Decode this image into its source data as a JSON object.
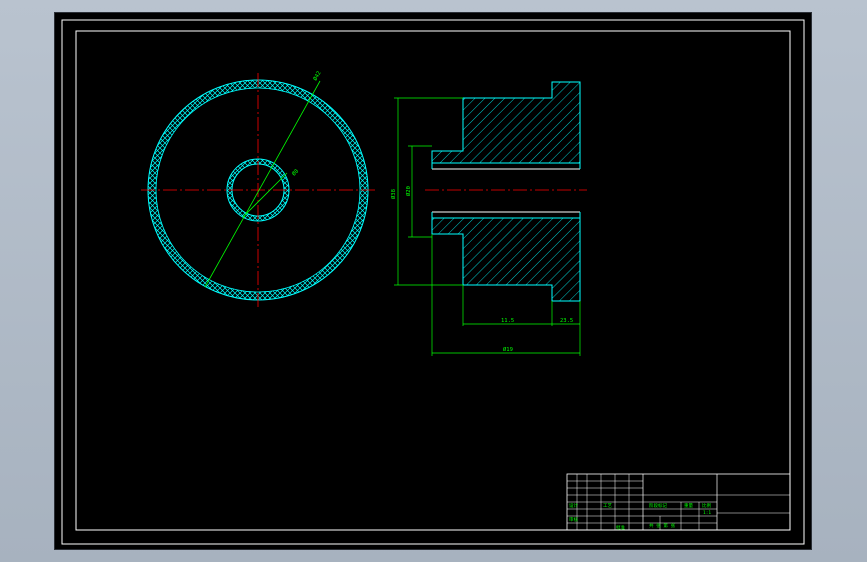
{
  "colors": {
    "background": "#000000",
    "frame": "#ffffff",
    "part_outline": "#00ffff",
    "hatch": "#00ffff",
    "dimension": "#00ff00",
    "centerline": "#ff0000"
  },
  "front_view": {
    "outer_diameter_label": "Ø42",
    "bore_diameter_label": "Ø8"
  },
  "section_view": {
    "overall_height_label": "Ø38",
    "bore_height_label": "Ø20",
    "body_length_label": "11.5",
    "flange_length_label": "23.5",
    "overall_length_label": "Ø19"
  },
  "title_block": {
    "left_row_labels": [
      "标记",
      "处数",
      "分区",
      "更改文件号",
      "签名",
      "年月日"
    ],
    "design_label": "设计",
    "review_label": "审核",
    "process_label": "工艺",
    "approve_label": "批准",
    "stage_label": "阶段标记",
    "weight_label": "重量",
    "scale_label": "比例",
    "scale_value": "1:1",
    "sheet_label": "共 张 第 张"
  }
}
